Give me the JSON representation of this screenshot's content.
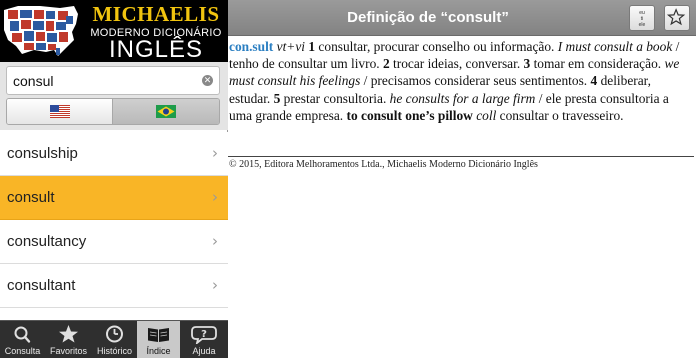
{
  "app": {
    "logo_brand": "MICHAELIS",
    "logo_subtitle": "MODERNO DICIONÁRIO",
    "logo_language": "INGLÊS"
  },
  "search": {
    "value": "consul",
    "placeholder": ""
  },
  "language_switch": {
    "left_flag": "us-flag-icon",
    "right_flag": "brazil-flag-icon",
    "selected": "left"
  },
  "word_list": [
    {
      "label": "consulship",
      "selected": false
    },
    {
      "label": "consult",
      "selected": true
    },
    {
      "label": "consultancy",
      "selected": false
    },
    {
      "label": "consultant",
      "selected": false
    }
  ],
  "tabs": [
    {
      "label": "Consulta",
      "icon": "search-icon",
      "active": false
    },
    {
      "label": "Favoritos",
      "icon": "star-icon",
      "active": false
    },
    {
      "label": "Histórico",
      "icon": "clock-icon",
      "active": false
    },
    {
      "label": "Índice",
      "icon": "book-icon",
      "active": true
    },
    {
      "label": "Ajuda",
      "icon": "help-bubble-icon",
      "active": false
    }
  ],
  "header": {
    "title": "Definição de “consult”",
    "encoding_button_lines": [
      "eu",
      "ti",
      "ele"
    ],
    "favorite_icon": "star-outline-icon"
  },
  "definition": {
    "headword": "con.sult",
    "pos": "vt+vi",
    "n1": "1",
    "t1": " consultar, procurar conselho ou informação. ",
    "ex1": "I must consult a book",
    "tr1": " / tenho de consultar um livro. ",
    "n2": "2",
    "t2": " trocar ideias, conversar. ",
    "n3": "3",
    "t3": " tomar em consideração. ",
    "ex3": "we must consult his feelings",
    "tr3": " / precisamos considerar seus sentimentos. ",
    "n4": "4",
    "t4": " deliberar, estudar. ",
    "n5": "5",
    "t5": " prestar consultoria. ",
    "ex5": "he consults for a large firm",
    "tr5": " / ele presta consultoria a uma grande empresa. ",
    "phrase": "to consult one’s pillow",
    "phrase_tag": "coll",
    "phrase_tr": " consultar o travesseiro."
  },
  "copyright": "© 2015, Editora Melhoramentos Ltda., Michaelis Moderno Dicionário Inglês",
  "colors": {
    "selected_row": "#f9b526",
    "headword": "#2b7fc2",
    "logo_brand": "#f1c40f",
    "tabbar": "#2f2f2f"
  }
}
